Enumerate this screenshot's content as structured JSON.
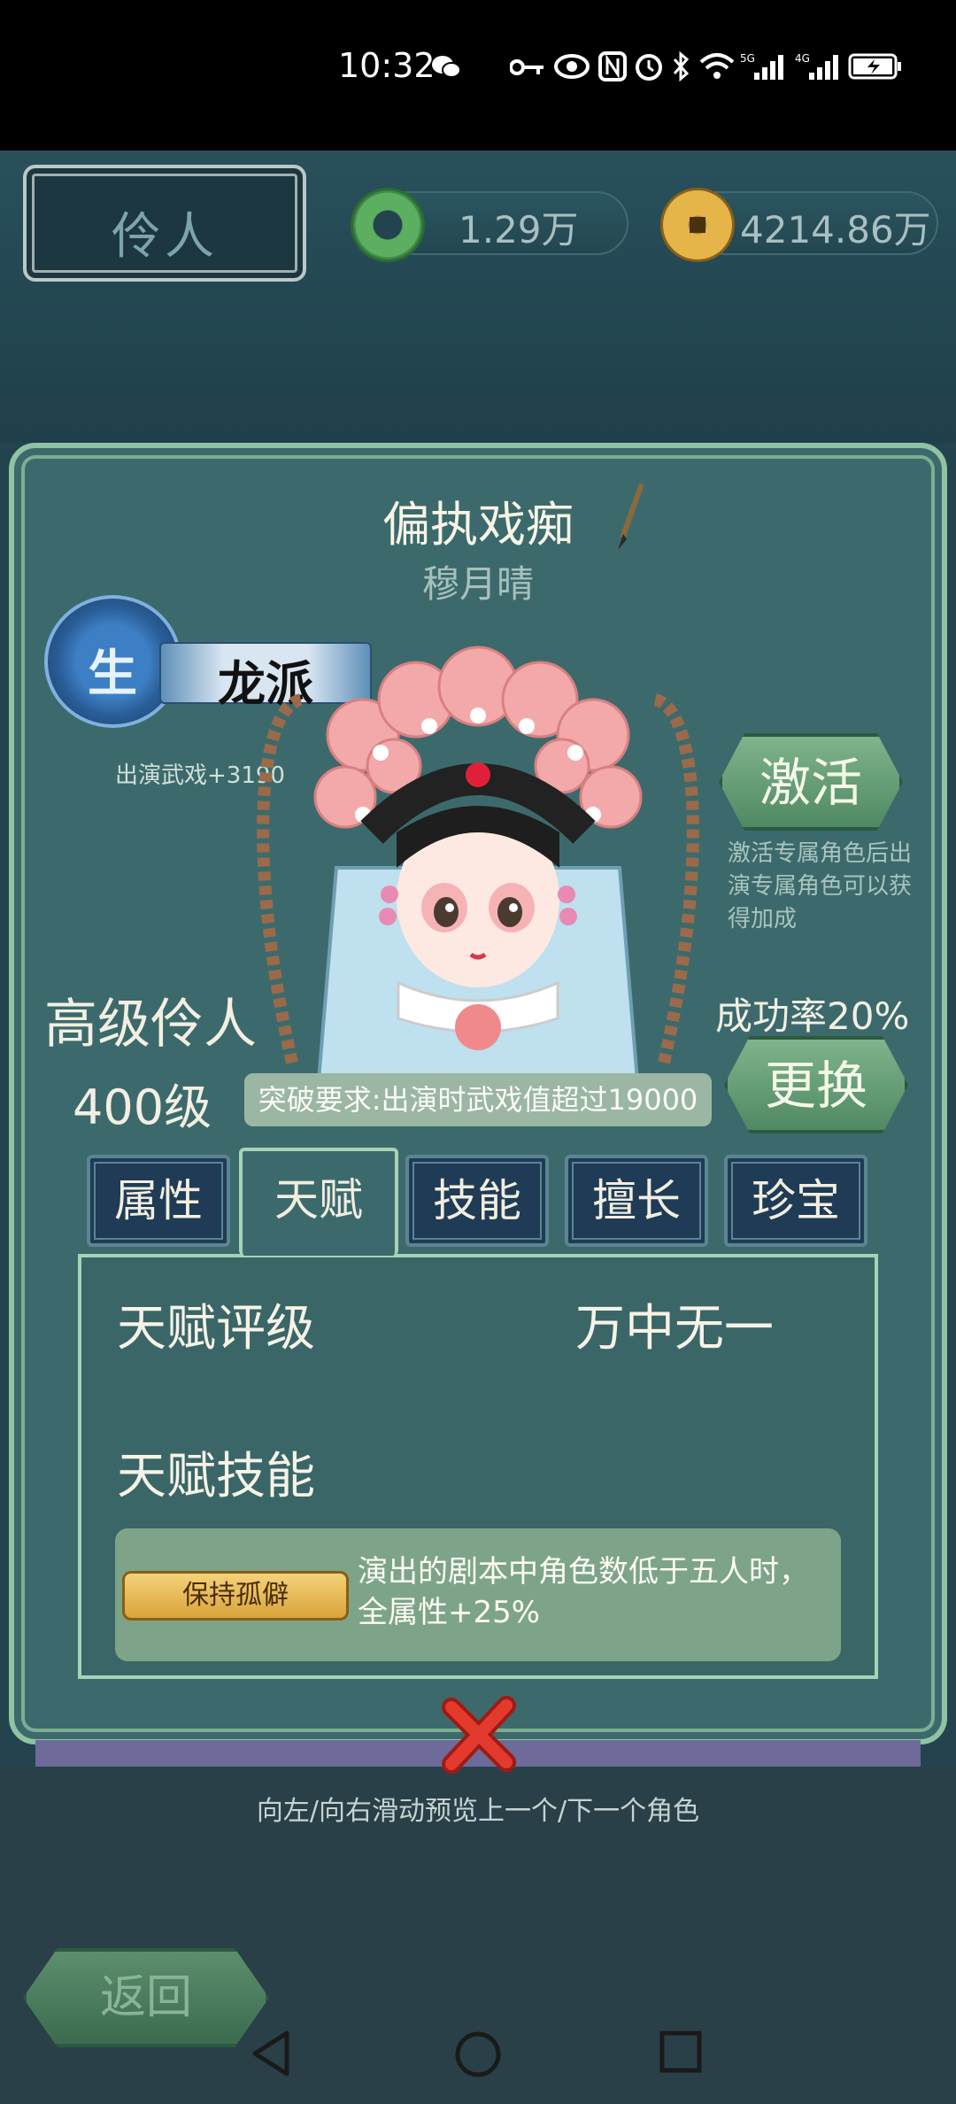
{
  "status_bar": {
    "time": "10:32",
    "icons": [
      "wechat-icon",
      "key-icon",
      "eye-icon",
      "nfc-icon",
      "alarm-icon",
      "bluetooth-icon",
      "wifi-icon",
      "signal-5g-icon",
      "signal-4g-icon",
      "battery-charging-icon"
    ]
  },
  "header": {
    "title": "伶人",
    "jade_amount": "1.29万",
    "coin_amount": "4214.86万"
  },
  "role": {
    "title": "偏执戏痴",
    "name": "穆月晴",
    "sect_char": "生",
    "sect_name": "龙派",
    "sect_bonus": "出演武戏+3190",
    "rank": "高级伶人",
    "level": "400级",
    "success_rate": "成功率20%",
    "breakthrough": "突破要求:出演时武戏值超过19000"
  },
  "buttons": {
    "activate": "激活",
    "activate_note": "激活专属角色后出演专属角色可以获得加成",
    "change": "更换",
    "back": "返回"
  },
  "tabs": [
    {
      "label": "属性"
    },
    {
      "label": "天赋"
    },
    {
      "label": "技能"
    },
    {
      "label": "擅长"
    },
    {
      "label": "珍宝"
    }
  ],
  "active_tab": "天赋",
  "talent": {
    "grade_label": "天赋评级",
    "grade_value": "万中无一",
    "skill_label": "天赋技能",
    "skill_name": "保持孤僻",
    "skill_desc": "演出的剧本中角色数低于五人时，全属性+25%"
  },
  "footer": {
    "swipe_hint": "向左/向右滑动预览上一个/下一个角色"
  },
  "colors": {
    "panel": "#3c6a6c",
    "panel_border": "#8fc3a3",
    "button_green": "#6fa47f",
    "tab_dark": "#1f3b55",
    "close_red": "#e23b2e"
  }
}
